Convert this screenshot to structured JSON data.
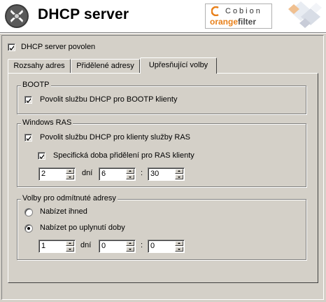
{
  "header": {
    "title": "DHCP server",
    "brand_top": "Cobion",
    "brand_orange": "orange",
    "brand_filter": "filter",
    "brand_colors": {
      "orange": "#e8801a",
      "gray": "#4a4a4a"
    }
  },
  "enable": {
    "label": "DHCP server povolen",
    "checked": true
  },
  "tabs": [
    {
      "label": "Rozsahy adres",
      "active": false
    },
    {
      "label": "Přidělené adresy",
      "active": false
    },
    {
      "label": "Upřesňující volby",
      "active": true
    }
  ],
  "bootp": {
    "title": "BOOTP",
    "option_label": "Povolit službu DHCP pro BOOTP klienty",
    "checked": true
  },
  "ras": {
    "title": "Windows RAS",
    "enable_label": "Povolit službu DHCP pro klienty služby RAS",
    "enable_checked": true,
    "specific_label": "Specifická doba přidělení pro RAS klienty",
    "specific_checked": true,
    "days": "2",
    "days_label": "dní",
    "hours": "6",
    "separator": ":",
    "minutes": "30"
  },
  "declined": {
    "title": "Volby pro odmítnuté adresy",
    "option_immediate": "Nabízet ihned",
    "option_after": "Nabízet po uplynutí doby",
    "selected": "after",
    "days": "1",
    "days_label": "dní",
    "hours": "0",
    "separator": ":",
    "minutes": "0"
  }
}
